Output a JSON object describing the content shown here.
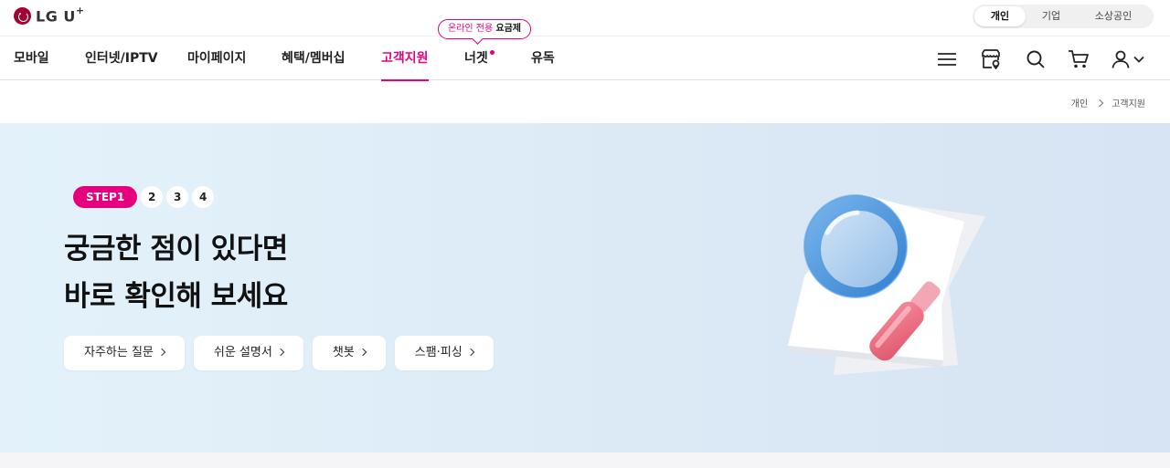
{
  "brand": {
    "name": "LG U",
    "plus": "+"
  },
  "segment": {
    "items": [
      "개인",
      "기업",
      "소상공인"
    ],
    "active": 0
  },
  "promo": {
    "highlight": "온라인 전용",
    "tail": "요금제"
  },
  "nav": {
    "items": [
      "모바일",
      "인터넷/IPTV",
      "마이페이지",
      "혜택/멤버십",
      "고객지원",
      "너겟",
      "유독"
    ],
    "active": 4
  },
  "icons": [
    "menu-icon",
    "store-location-icon",
    "search-icon",
    "cart-icon",
    "user-icon",
    "chevron-down-icon"
  ],
  "breadcrumb": [
    "개인",
    "고객지원"
  ],
  "hero": {
    "step_active": "STEP1",
    "steps": [
      "2",
      "3",
      "4"
    ],
    "headline": [
      "궁금한 점이 있다면",
      "바로 확인해 보세요"
    ],
    "chips": [
      "자주하는 질문",
      "쉬운 설명서",
      "챗봇",
      "스팸·피싱"
    ]
  },
  "colors": {
    "accent": "#e6007e",
    "logo": "#a50034",
    "hero_bg": "#dceaf6"
  }
}
